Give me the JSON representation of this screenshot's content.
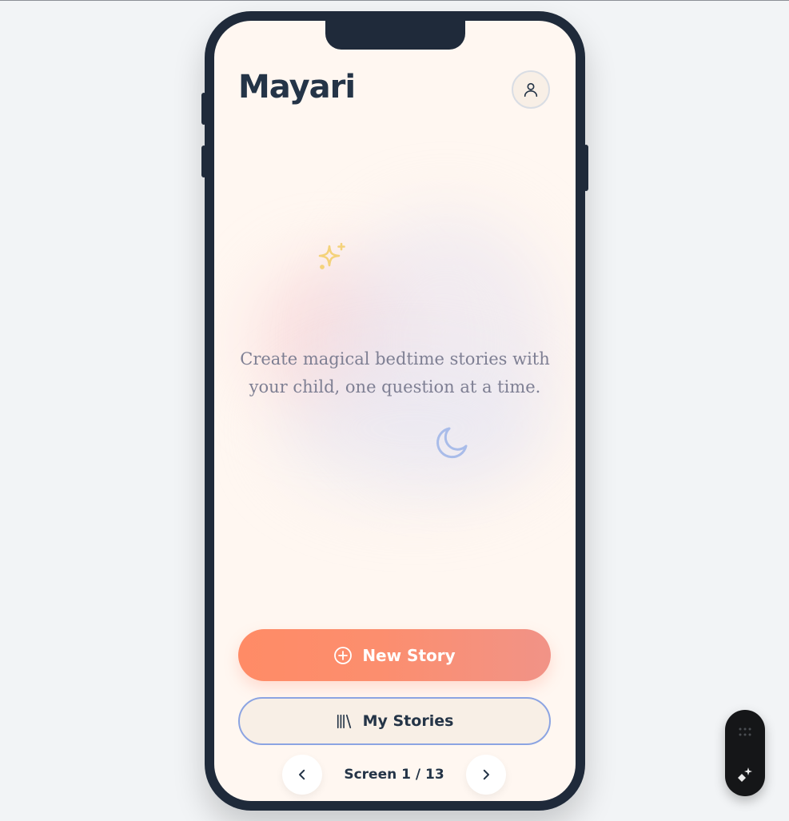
{
  "app": {
    "title": "Mayari",
    "tagline": "Create magical bedtime stories with your child, one question at a time."
  },
  "header": {
    "profile_icon": "user-icon"
  },
  "decorations": {
    "sparkle_icon": "sparkle-icon",
    "moon_icon": "moon-icon"
  },
  "actions": {
    "new_story_label": "New Story",
    "new_story_icon": "plus-circle-icon",
    "my_stories_label": "My Stories",
    "my_stories_icon": "library-icon"
  },
  "pager": {
    "label": "Screen 1 / 13",
    "current": 1,
    "total": 13
  },
  "toolbar": {
    "grip_icon": "drag-handle-icon",
    "magic_icon": "magic-wand-icon"
  },
  "colors": {
    "brand_dark": "#243447",
    "accent_coral": "#ff8b66",
    "accent_blue": "#8ca4e2",
    "sparkle_yellow": "#f4d27a",
    "moon_blue": "#a9bce9",
    "background": "#fff7f1"
  }
}
